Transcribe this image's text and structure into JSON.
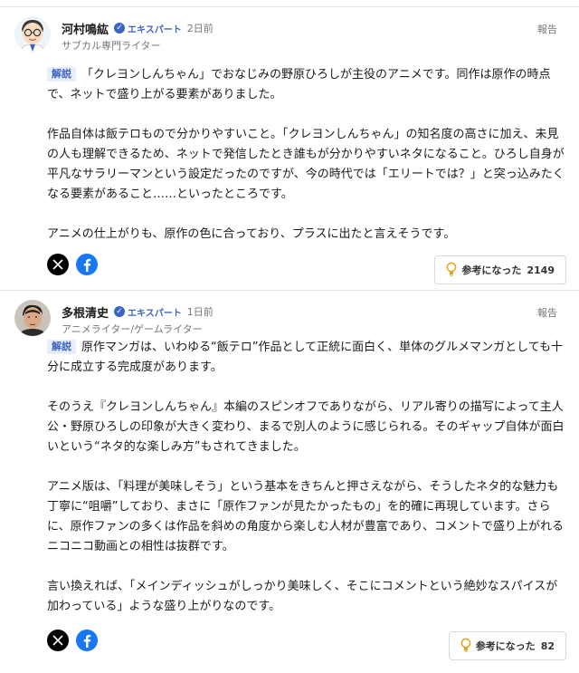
{
  "comments": [
    {
      "author": "河村鳴紘",
      "badge": "エキスパート",
      "time": "2日前",
      "subtitle": "サブカル専門ライター",
      "report": "報告",
      "label": "解説",
      "paragraphs": [
        "「クレヨンしんちゃん」でおなじみの野原ひろしが主役のアニメです。同作は原作の時点で、ネットで盛り上がる要素がありました。",
        "作品自体は飯テロもので分かりやすいこと。「クレヨンしんちゃん」の知名度の高さに加え、未見の人も理解できるため、ネットで発信したとき誰もが分かりやすいネタになること。ひろし自身が平凡なサラリーマンという設定だったのですが、今の時代では「エリートでは？」と突っ込みたくなる要素があること……といったところです。",
        "アニメの仕上がりも、原作の色に合っており、プラスに出たと言えそうです。"
      ],
      "helpful_label": "参考になった",
      "helpful_count": "2149"
    },
    {
      "author": "多根清史",
      "badge": "エキスパート",
      "time": "1日前",
      "subtitle": "アニメライター/ゲームライター",
      "report": "報告",
      "label": "解説",
      "paragraphs": [
        "原作マンガは、いわゆる“飯テロ”作品として正統に面白く、単体のグルメマンガとしても十分に成立する完成度があります。",
        "そのうえ『クレヨンしんちゃん』本編のスピンオフでありながら、リアル寄りの描写によって主人公・野原ひろしの印象が大きく変わり、まるで別人のように感じられる。そのギャップ自体が面白いという“ネタ的な楽しみ方”もされてきました。",
        "アニメ版は、「料理が美味しそう」という基本をきちんと押さえながら、そうしたネタ的な魅力も丁寧に“咀嚼”しており、まさに「原作ファンが見たかったもの」を的確に再現しています。さらに、原作ファンの多くは作品を斜めの角度から楽しむ人材が豊富であり、コメントで盛り上がれるニコニコ動画との相性は抜群です。",
        "言い換えれば、「メインディッシュがしっかり美味しく、そこにコメントという絶妙なスパイスが加わっている」ような盛り上がりなのです。"
      ],
      "helpful_label": "参考になった",
      "helpful_count": "82"
    }
  ],
  "icons": {
    "verified": "verified-check-icon",
    "x": "x-logo-icon",
    "facebook": "facebook-logo-icon",
    "bulb": "lightbulb-icon"
  }
}
